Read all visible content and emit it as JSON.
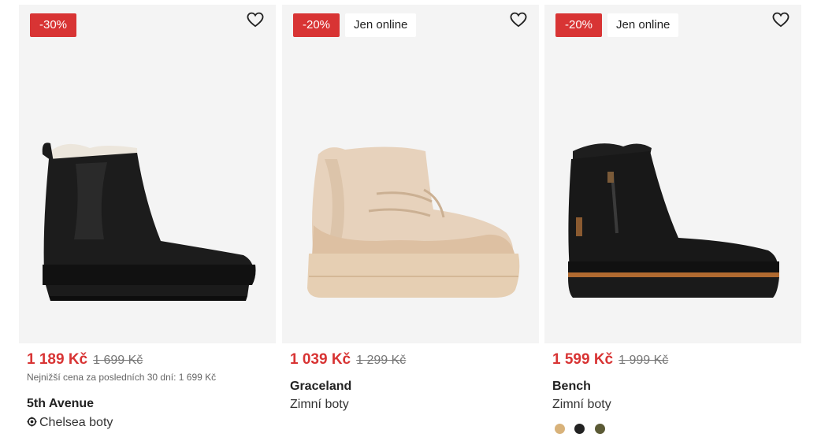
{
  "products": [
    {
      "discount": "-30%",
      "online_label": "",
      "price_new": "1 189 Kč",
      "price_old": "1 699 Kč",
      "lowest_price": "Nejnižší cena za posledních 30 dní: 1 699 Kč",
      "brand": "5th Avenue",
      "category": "Chelsea boty",
      "category_icon": "sustainable-icon",
      "image": "black-chelsea-boot"
    },
    {
      "discount": "-20%",
      "online_label": "Jen online",
      "price_new": "1 039 Kč",
      "price_old": "1 299 Kč",
      "brand": "Graceland",
      "category": "Zimní boty",
      "image": "beige-teddy-boot"
    },
    {
      "discount": "-20%",
      "online_label": "Jen online",
      "price_new": "1 599 Kč",
      "price_old": "1 999 Kč",
      "brand": "Bench",
      "category": "Zimní boty",
      "image": "black-suede-winter-boot",
      "color_swatches": [
        "#d8b27a",
        "#222222",
        "#5b5a35"
      ]
    }
  ],
  "colors": {
    "accent": "#d83434",
    "card_bg": "#f4f4f4"
  }
}
